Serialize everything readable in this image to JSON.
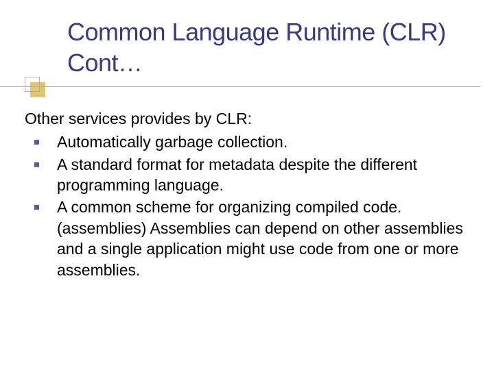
{
  "title": "Common Language Runtime (CLR) Cont…",
  "intro": "Other services provides by CLR:",
  "bullets": [
    "Automatically garbage collection.",
    "A standard format for metadata despite the different programming language.",
    "A common scheme for organizing compiled code. (assemblies) Assemblies can depend on other assemblies and a single application might use code from one or more assemblies."
  ]
}
